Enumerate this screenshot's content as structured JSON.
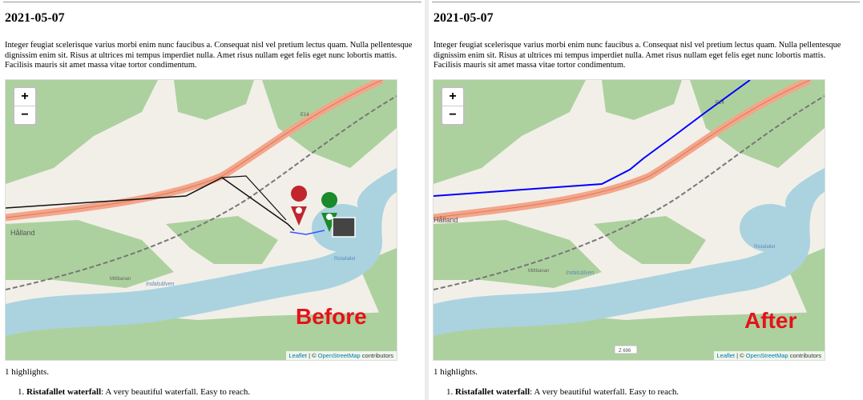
{
  "panes": [
    {
      "id": "before",
      "date": "2021-05-07",
      "paragraph": "Integer feugiat scelerisque varius morbi enim nunc faucibus a. Consequat nisl vel pretium lectus quam. Nulla pellentesque dignissim enim sit. Risus at ultrices mi tempus imperdiet nulla. Amet risus nullam eget felis eget nunc lobortis mattis. Facilisis mauris sit amet massa vitae tortor condimentum.",
      "stamp": "Before",
      "highlights_count": "1 highlights.",
      "item_number": "1.",
      "item_name": "Ristafallet waterfall",
      "item_desc": ": A very beautiful waterfall. Easy to reach."
    },
    {
      "id": "after",
      "date": "2021-05-07",
      "paragraph": "Integer feugiat scelerisque varius morbi enim nunc faucibus a. Consequat nisl vel pretium lectus quam. Nulla pellentesque dignissim enim sit. Risus at ultrices mi tempus imperdiet nulla. Amet risus nullam eget felis eget nunc lobortis mattis. Facilisis mauris sit amet massa vitae tortor condimentum.",
      "stamp": "After",
      "highlights_count": "1 highlights.",
      "item_number": "1.",
      "item_name": "Ristafallet waterfall",
      "item_desc": ": A very beautiful waterfall. Easy to reach."
    }
  ],
  "map": {
    "zoom_in": "+",
    "zoom_out": "−",
    "attribution_leaflet": "Leaflet",
    "attribution_sep": " | © ",
    "attribution_osm": "OpenStreetMap",
    "attribution_rest": " contributors",
    "labels": {
      "halland": "Hålland",
      "river": "Indalsälven",
      "rail1": "Mittbanan",
      "rail2": "Mittbanan",
      "waterfall": "Ristafallet",
      "road": "E14",
      "road_z": "Z 696"
    }
  },
  "colors": {
    "water": "#aad3df",
    "forest": "#add19e",
    "land": "#f2efe9",
    "road": "#f4a58a",
    "route_blue": "#0000ff",
    "stamp_red": "#e8101a"
  }
}
